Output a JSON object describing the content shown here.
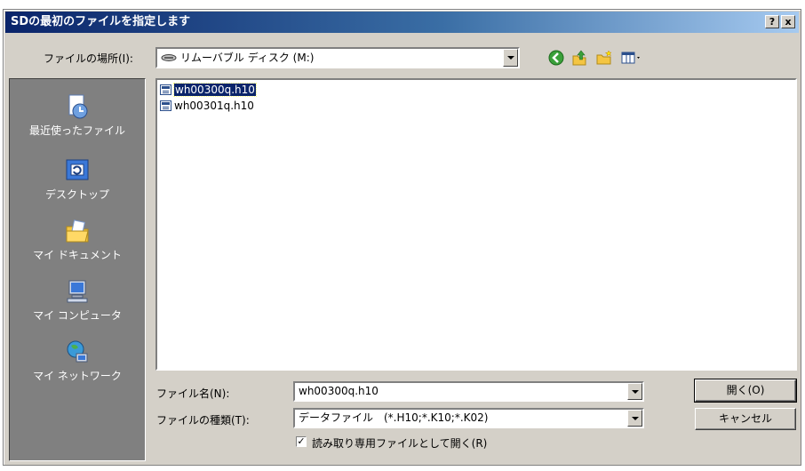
{
  "window": {
    "title": "SDの最初のファイルを指定します",
    "help_button": "?",
    "close_button": "x"
  },
  "location": {
    "label": "ファイルの場所(I):",
    "value": "リムーバブル ディスク (M:)"
  },
  "places": [
    {
      "label": "最近使ったファイル",
      "icon": "recent-files-icon"
    },
    {
      "label": "デスクトップ",
      "icon": "desktop-icon"
    },
    {
      "label": "マイ ドキュメント",
      "icon": "my-documents-icon"
    },
    {
      "label": "マイ コンピュータ",
      "icon": "my-computer-icon"
    },
    {
      "label": "マイ ネットワーク",
      "icon": "my-network-icon"
    }
  ],
  "files": [
    {
      "name": "wh00300q.h10",
      "selected": true
    },
    {
      "name": "wh00301q.h10",
      "selected": false
    }
  ],
  "filename": {
    "label": "ファイル名(N):",
    "value": "wh00300q.h10"
  },
  "filetype": {
    "label": "ファイルの種類(T):",
    "value": "データファイル　(*.H10;*.K10;*.K02)"
  },
  "readonly": {
    "label": "読み取り専用ファイルとして開く(R)",
    "checked": true,
    "check_mark": "✓"
  },
  "buttons": {
    "open": "開く(O)",
    "cancel": "キャンセル"
  },
  "toolbar": [
    "back-icon",
    "up-folder-icon",
    "new-folder-icon",
    "view-menu-icon"
  ],
  "colors": {
    "title_start": "#0a246a",
    "title_end": "#a6caf0",
    "face": "#d4d0c8",
    "places_bg": "#808080",
    "selection": "#0a246a"
  }
}
